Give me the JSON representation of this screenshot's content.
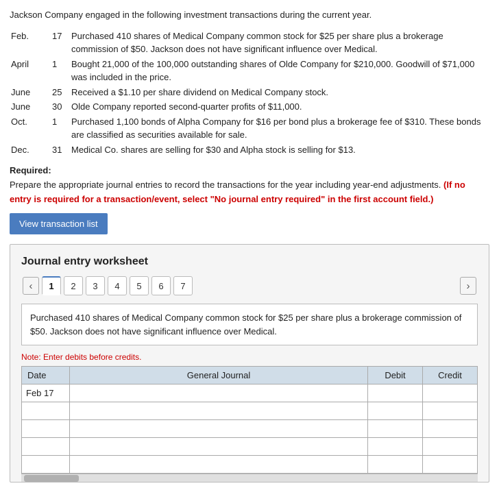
{
  "intro": {
    "opening": "Jackson Company engaged in the following investment transactions during the current year.",
    "transactions": [
      {
        "month": "Feb.",
        "day": "17",
        "text": "Purchased 410 shares of Medical Company common stock for $25 per share plus a brokerage commission of $50. Jackson does not have significant influence over Medical."
      },
      {
        "month": "April",
        "day": "1",
        "text": "Bought 21,000 of the 100,000 outstanding shares of Olde Company for $210,000. Goodwill of $71,000 was included in the price."
      },
      {
        "month": "June",
        "day": "25",
        "text": "Received a $1.10 per share dividend on Medical Company stock."
      },
      {
        "month": "June",
        "day": "30",
        "text": "Olde Company reported second-quarter profits of $11,000."
      },
      {
        "month": "Oct.",
        "day": "1",
        "text": "Purchased 1,100 bonds of Alpha Company for $16 per bond plus a brokerage fee of $310. These bonds are classified as securities available for sale."
      },
      {
        "month": "Dec.",
        "day": "31",
        "text": "Medical Co. shares are selling for $30 and Alpha stock is selling for $13."
      }
    ]
  },
  "required": {
    "label": "Required:",
    "instruction": "Prepare the appropriate journal entries to record the transactions for the year including year-end adjustments.",
    "warning": "(If no entry is required for a transaction/event, select \"No journal entry required\" in the first account field.)"
  },
  "viewBtn": {
    "label": "View transaction list"
  },
  "worksheet": {
    "title": "Journal entry worksheet",
    "tabs": [
      "1",
      "2",
      "3",
      "4",
      "5",
      "6",
      "7"
    ],
    "activeTab": 0,
    "description": "Purchased 410 shares of Medical Company common stock for $25 per share plus a brokerage commission of $50. Jackson does not have significant influence over Medical.",
    "note": "Note: Enter debits before credits.",
    "table": {
      "headers": [
        "Date",
        "General Journal",
        "Debit",
        "Credit"
      ],
      "rows": [
        {
          "date": "Feb 17",
          "gj": "",
          "debit": "",
          "credit": ""
        },
        {
          "date": "",
          "gj": "",
          "debit": "",
          "credit": ""
        },
        {
          "date": "",
          "gj": "",
          "debit": "",
          "credit": ""
        },
        {
          "date": "",
          "gj": "",
          "debit": "",
          "credit": ""
        },
        {
          "date": "",
          "gj": "",
          "debit": "",
          "credit": ""
        }
      ]
    }
  }
}
